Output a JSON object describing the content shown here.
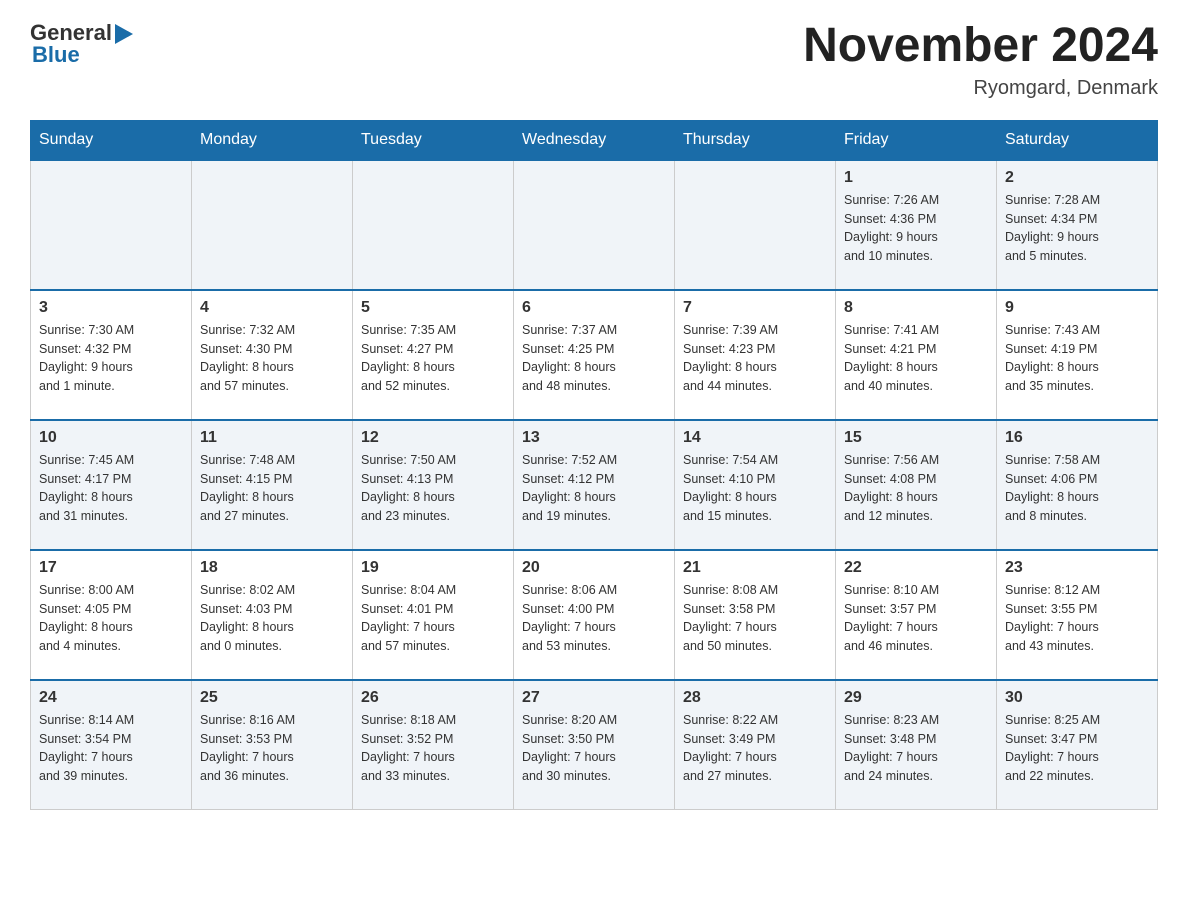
{
  "header": {
    "logo_general": "General",
    "logo_blue": "Blue",
    "month_title": "November 2024",
    "location": "Ryomgard, Denmark"
  },
  "days_of_week": [
    "Sunday",
    "Monday",
    "Tuesday",
    "Wednesday",
    "Thursday",
    "Friday",
    "Saturday"
  ],
  "weeks": [
    [
      {
        "day": "",
        "info": ""
      },
      {
        "day": "",
        "info": ""
      },
      {
        "day": "",
        "info": ""
      },
      {
        "day": "",
        "info": ""
      },
      {
        "day": "",
        "info": ""
      },
      {
        "day": "1",
        "info": "Sunrise: 7:26 AM\nSunset: 4:36 PM\nDaylight: 9 hours\nand 10 minutes."
      },
      {
        "day": "2",
        "info": "Sunrise: 7:28 AM\nSunset: 4:34 PM\nDaylight: 9 hours\nand 5 minutes."
      }
    ],
    [
      {
        "day": "3",
        "info": "Sunrise: 7:30 AM\nSunset: 4:32 PM\nDaylight: 9 hours\nand 1 minute."
      },
      {
        "day": "4",
        "info": "Sunrise: 7:32 AM\nSunset: 4:30 PM\nDaylight: 8 hours\nand 57 minutes."
      },
      {
        "day": "5",
        "info": "Sunrise: 7:35 AM\nSunset: 4:27 PM\nDaylight: 8 hours\nand 52 minutes."
      },
      {
        "day": "6",
        "info": "Sunrise: 7:37 AM\nSunset: 4:25 PM\nDaylight: 8 hours\nand 48 minutes."
      },
      {
        "day": "7",
        "info": "Sunrise: 7:39 AM\nSunset: 4:23 PM\nDaylight: 8 hours\nand 44 minutes."
      },
      {
        "day": "8",
        "info": "Sunrise: 7:41 AM\nSunset: 4:21 PM\nDaylight: 8 hours\nand 40 minutes."
      },
      {
        "day": "9",
        "info": "Sunrise: 7:43 AM\nSunset: 4:19 PM\nDaylight: 8 hours\nand 35 minutes."
      }
    ],
    [
      {
        "day": "10",
        "info": "Sunrise: 7:45 AM\nSunset: 4:17 PM\nDaylight: 8 hours\nand 31 minutes."
      },
      {
        "day": "11",
        "info": "Sunrise: 7:48 AM\nSunset: 4:15 PM\nDaylight: 8 hours\nand 27 minutes."
      },
      {
        "day": "12",
        "info": "Sunrise: 7:50 AM\nSunset: 4:13 PM\nDaylight: 8 hours\nand 23 minutes."
      },
      {
        "day": "13",
        "info": "Sunrise: 7:52 AM\nSunset: 4:12 PM\nDaylight: 8 hours\nand 19 minutes."
      },
      {
        "day": "14",
        "info": "Sunrise: 7:54 AM\nSunset: 4:10 PM\nDaylight: 8 hours\nand 15 minutes."
      },
      {
        "day": "15",
        "info": "Sunrise: 7:56 AM\nSunset: 4:08 PM\nDaylight: 8 hours\nand 12 minutes."
      },
      {
        "day": "16",
        "info": "Sunrise: 7:58 AM\nSunset: 4:06 PM\nDaylight: 8 hours\nand 8 minutes."
      }
    ],
    [
      {
        "day": "17",
        "info": "Sunrise: 8:00 AM\nSunset: 4:05 PM\nDaylight: 8 hours\nand 4 minutes."
      },
      {
        "day": "18",
        "info": "Sunrise: 8:02 AM\nSunset: 4:03 PM\nDaylight: 8 hours\nand 0 minutes."
      },
      {
        "day": "19",
        "info": "Sunrise: 8:04 AM\nSunset: 4:01 PM\nDaylight: 7 hours\nand 57 minutes."
      },
      {
        "day": "20",
        "info": "Sunrise: 8:06 AM\nSunset: 4:00 PM\nDaylight: 7 hours\nand 53 minutes."
      },
      {
        "day": "21",
        "info": "Sunrise: 8:08 AM\nSunset: 3:58 PM\nDaylight: 7 hours\nand 50 minutes."
      },
      {
        "day": "22",
        "info": "Sunrise: 8:10 AM\nSunset: 3:57 PM\nDaylight: 7 hours\nand 46 minutes."
      },
      {
        "day": "23",
        "info": "Sunrise: 8:12 AM\nSunset: 3:55 PM\nDaylight: 7 hours\nand 43 minutes."
      }
    ],
    [
      {
        "day": "24",
        "info": "Sunrise: 8:14 AM\nSunset: 3:54 PM\nDaylight: 7 hours\nand 39 minutes."
      },
      {
        "day": "25",
        "info": "Sunrise: 8:16 AM\nSunset: 3:53 PM\nDaylight: 7 hours\nand 36 minutes."
      },
      {
        "day": "26",
        "info": "Sunrise: 8:18 AM\nSunset: 3:52 PM\nDaylight: 7 hours\nand 33 minutes."
      },
      {
        "day": "27",
        "info": "Sunrise: 8:20 AM\nSunset: 3:50 PM\nDaylight: 7 hours\nand 30 minutes."
      },
      {
        "day": "28",
        "info": "Sunrise: 8:22 AM\nSunset: 3:49 PM\nDaylight: 7 hours\nand 27 minutes."
      },
      {
        "day": "29",
        "info": "Sunrise: 8:23 AM\nSunset: 3:48 PM\nDaylight: 7 hours\nand 24 minutes."
      },
      {
        "day": "30",
        "info": "Sunrise: 8:25 AM\nSunset: 3:47 PM\nDaylight: 7 hours\nand 22 minutes."
      }
    ]
  ]
}
